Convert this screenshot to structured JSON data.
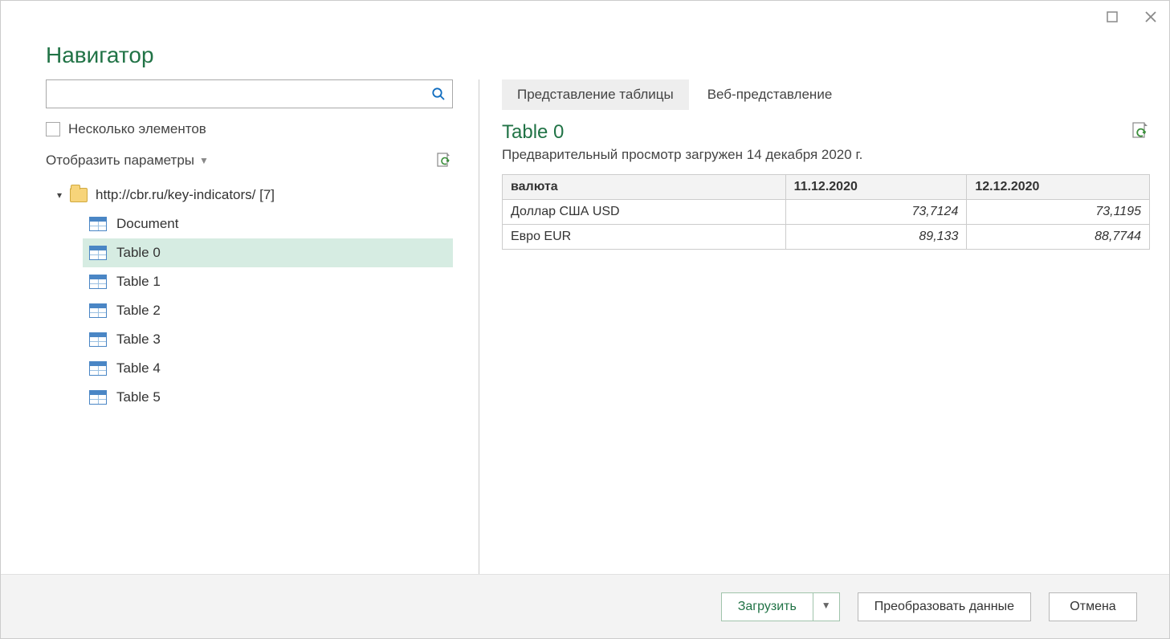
{
  "window": {
    "title": "Навигатор"
  },
  "left": {
    "search_placeholder": "",
    "multi_select_label": "Несколько элементов",
    "display_options_label": "Отобразить параметры",
    "tree": {
      "root_label": "http://cbr.ru/key-indicators/ [7]",
      "items": [
        {
          "label": "Document",
          "selected": false
        },
        {
          "label": "Table 0",
          "selected": true
        },
        {
          "label": "Table 1",
          "selected": false
        },
        {
          "label": "Table 2",
          "selected": false
        },
        {
          "label": "Table 3",
          "selected": false
        },
        {
          "label": "Table 4",
          "selected": false
        },
        {
          "label": "Table 5",
          "selected": false
        }
      ]
    }
  },
  "right": {
    "tabs": {
      "table_view": "Представление таблицы",
      "web_view": "Веб-представление"
    },
    "preview_title": "Table 0",
    "preview_subtitle": "Предварительный просмотр загружен 14 декабря 2020 г.",
    "table": {
      "headers": [
        "валюта",
        "11.12.2020",
        "12.12.2020"
      ],
      "rows": [
        [
          "Доллар США USD",
          "73,7124",
          "73,1195"
        ],
        [
          "Евро EUR",
          "89,133",
          "88,7744"
        ]
      ]
    }
  },
  "footer": {
    "load": "Загрузить",
    "transform": "Преобразовать данные",
    "cancel": "Отмена"
  }
}
